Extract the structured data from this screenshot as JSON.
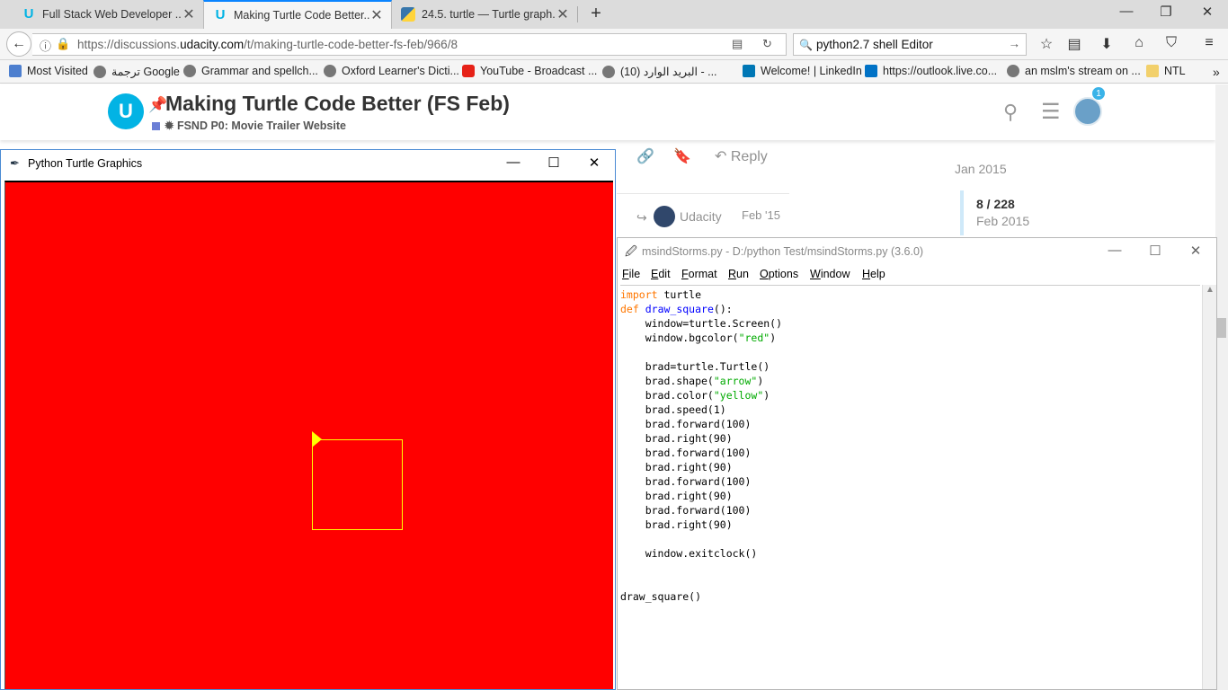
{
  "browser": {
    "tabs": [
      {
        "title": "Full Stack Web Developer ...",
        "icon": "udacity-favicon",
        "active": false
      },
      {
        "title": "Making Turtle Code Better...",
        "icon": "udacity-favicon",
        "active": true
      },
      {
        "title": "24.5. turtle — Turtle graph...",
        "icon": "python-favicon",
        "active": false
      }
    ],
    "url_prefix": "https://discussions.",
    "url_domain": "udacity.com",
    "url_path": "/t/making-turtle-code-better-fs-feb/966/8",
    "search_value": "python2.7 shell Editor",
    "bookmarks": [
      {
        "label": "Most Visited"
      },
      {
        "label": "ترجمة Google"
      },
      {
        "label": "Grammar and spellch..."
      },
      {
        "label": "Oxford Learner's Dicti..."
      },
      {
        "label": "YouTube - Broadcast ..."
      },
      {
        "label": "البريد الوارد (10) - ..."
      },
      {
        "label": "Welcome! | LinkedIn"
      },
      {
        "label": "https://outlook.live.co..."
      },
      {
        "label": "an mslm's stream on ..."
      },
      {
        "label": "NTL"
      }
    ],
    "chevron": "»"
  },
  "page": {
    "topic_title": "Making Turtle Code Better (FS Feb)",
    "category": "FSND P0: Movie Trailer Website",
    "notification_count": "1",
    "reply_label": "Reply",
    "reply_user": "Udacity",
    "reply_date": "Feb '15",
    "timeline_top": "Jan 2015",
    "timeline_count": "8 / 228",
    "timeline_date": "Feb 2015",
    "accent_color": "#02b3e4"
  },
  "turtle_window": {
    "title": "Python Turtle Graphics",
    "bgcolor": "red",
    "pen_color": "yellow"
  },
  "idle_window": {
    "title": "msindStorms.py - D:/python Test/msindStorms.py (3.6.0)",
    "menu": [
      {
        "label": "File",
        "hotkey": "F",
        "rest": "ile"
      },
      {
        "label": "Edit",
        "hotkey": "E",
        "rest": "dit"
      },
      {
        "label": "Format",
        "hotkey": "F",
        "rest": "ormat"
      },
      {
        "label": "Run",
        "hotkey": "R",
        "rest": "un"
      },
      {
        "label": "Options",
        "hotkey": "O",
        "rest": "ptions"
      },
      {
        "label": "Window",
        "hotkey": "W",
        "rest": "indow"
      },
      {
        "label": "Help",
        "hotkey": "H",
        "rest": "elp"
      }
    ],
    "code_lines": [
      "import turtle",
      "def draw_square():",
      "    window=turtle.Screen()",
      "    window.bgcolor(\"red\")",
      "",
      "    brad=turtle.Turtle()",
      "    brad.shape(\"arrow\")",
      "    brad.color(\"yellow\")",
      "    brad.speed(1)",
      "    brad.forward(100)",
      "    brad.right(90)",
      "    brad.forward(100)",
      "    brad.right(90)",
      "    brad.forward(100)",
      "    brad.right(90)",
      "    brad.forward(100)",
      "    brad.right(90)",
      "",
      "    window.exitclock()",
      "",
      "",
      "draw_square()"
    ]
  }
}
